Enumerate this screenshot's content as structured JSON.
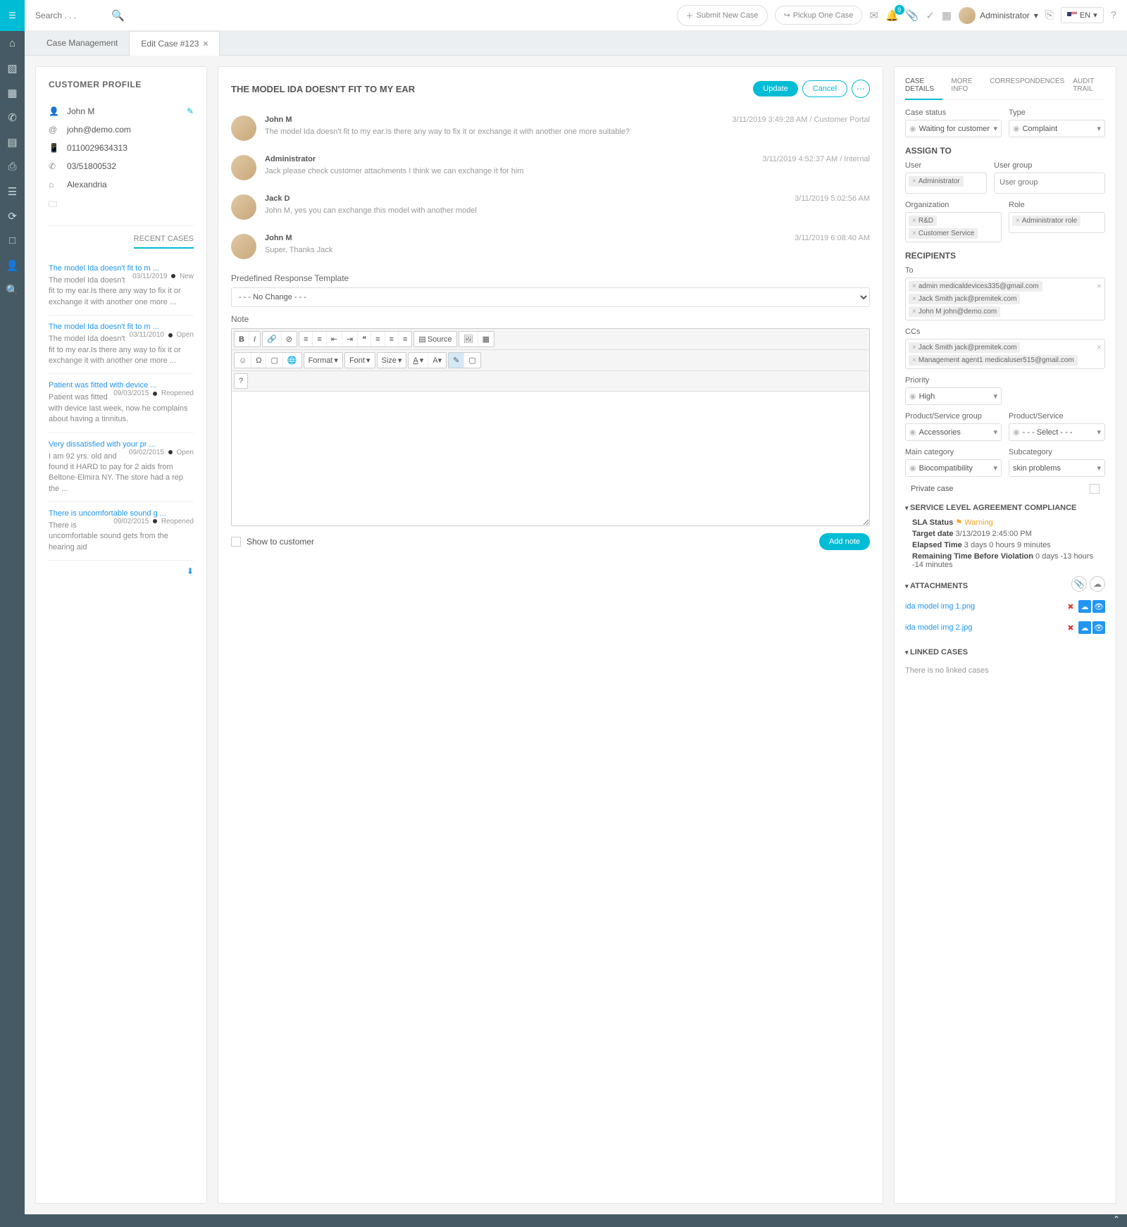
{
  "topbar": {
    "search_placeholder": "Search . . .",
    "submit": "Submit New Case",
    "pickup": "Pickup One Case",
    "notif_count": "9",
    "user": "Administrator",
    "lang": "EN"
  },
  "tabs": {
    "t1": "Case Management",
    "t2": "Edit Case #123"
  },
  "profile": {
    "heading": "CUSTOMER PROFILE",
    "name": "John M",
    "email": "john@demo.com",
    "phone": "0110029634313",
    "fax": "03/51800532",
    "city": "Alexandria",
    "recent_label": "RECENT CASES",
    "recent": [
      {
        "title": "The model Ida doesn't fit to m ...",
        "date": "03/11/2019",
        "status": "New",
        "body": "The model Ida doesn't fit to my ear.Is there any way to fix it or exchange it with another one more ..."
      },
      {
        "title": "The model Ida doesn't fit to m ...",
        "date": "03/11/2010",
        "status": "Open",
        "body": "The model Ida doesn't fit to my ear.Is there any way to fix it or exchange it with another one more ..."
      },
      {
        "title": "Patient was fitted with device ...",
        "date": "09/03/2015",
        "status": "Reopened",
        "body": "Patient was fitted with device last week, now he complains about having a tinnitus."
      },
      {
        "title": "Very dissatisfied with your pr ...",
        "date": "09/02/2015",
        "status": "Open",
        "body": "I am 92 yrs. old and found it HARD to pay for 2 aids from Beltone-Elmira NY. The store had a rep the ..."
      },
      {
        "title": "There is uncomfortable sound g ...",
        "date": "09/02/2015",
        "status": "Reopened",
        "body": "There is uncomfortable sound gets from the hearing aid"
      }
    ]
  },
  "thread": {
    "title": "THE MODEL IDA DOESN'T FIT TO MY EAR",
    "update": "Update",
    "cancel": "Cancel",
    "msgs": [
      {
        "author": "John M",
        "ts": "3/11/2019 3:49:28 AM / Customer Portal",
        "body": "The model Ida doesn't fit to my ear.Is there any way to fix it or exchange it with another one more suitable?"
      },
      {
        "author": "Administrator",
        "ts": "3/11/2019 4:52:37 AM / Internal",
        "body": "Jack please check customer attachments I think we can exchange it for him"
      },
      {
        "author": "Jack D",
        "ts": "3/11/2019 5:02:56 AM",
        "body": "John M, yes you can exchange this model with another model"
      },
      {
        "author": "John M",
        "ts": "3/11/2019 6:08:40 AM",
        "body": "Super, Thanks Jack"
      }
    ],
    "template_label": "Predefined Response Template",
    "template_val": "- - - No Change - - -",
    "note_label": "Note",
    "source_btn": "Source",
    "format": "Format",
    "font": "Font",
    "size": "Size",
    "show_customer": "Show to customer",
    "add_note": "Add note"
  },
  "details": {
    "tabs": {
      "d1": "CASE DETAILS",
      "d2": "MORE INFO",
      "d3": "CORRESPONDENCES",
      "d4": "AUDIT TRAIL"
    },
    "case_status_l": "Case status",
    "case_status_v": "Waiting for customer",
    "type_l": "Type",
    "type_v": "Complaint",
    "assign_head": "ASSIGN TO",
    "user_l": "User",
    "user_tag": "Administrator",
    "usergroup_l": "User group",
    "usergroup_ph": "User group",
    "org_l": "Organization",
    "org_tag1": "R&D",
    "org_tag2": "Customer Service",
    "role_l": "Role",
    "role_tag": "Administrator role",
    "recip_head": "RECIPIENTS",
    "to_l": "To",
    "to1": "admin medicaldevices335@gmail.com",
    "to2": "Jack Smith jack@premitek.com",
    "to3": "John M john@demo.com",
    "cc_l": "CCs",
    "cc1": "Jack Smith jack@premitek.com",
    "cc2": "Management agent1 medicaluser515@gmail.com",
    "priority_l": "Priority",
    "priority_v": "High",
    "psg_l": "Product/Service group",
    "psg_v": "Accessories",
    "ps_l": "Product/Service",
    "ps_v": "- - - Select - - -",
    "maincat_l": "Main category",
    "maincat_v": "Biocompatibility",
    "subcat_l": "Subcategory",
    "subcat_v": "skin problems",
    "private": "Private case",
    "sla_head": "SERVICE LEVEL AGREEMENT COMPLIANCE",
    "sla_status_l": "SLA Status",
    "sla_status_v": "Warning",
    "target_l": "Target date",
    "target_v": "3/13/2019 2:45:00 PM",
    "elapsed_l": "Elapsed Time",
    "elapsed_v": "3 days 0 hours 9 minutes",
    "remain_l": "Remaining Time Before Violation",
    "remain_v": "0 days -13 hours -14 minutes",
    "attach_head": "ATTACHMENTS",
    "att1": "ida model img 1.png",
    "att2": "ida model img 2.jpg",
    "linked_head": "LINKED CASES",
    "linked_empty": "There is no linked cases"
  }
}
